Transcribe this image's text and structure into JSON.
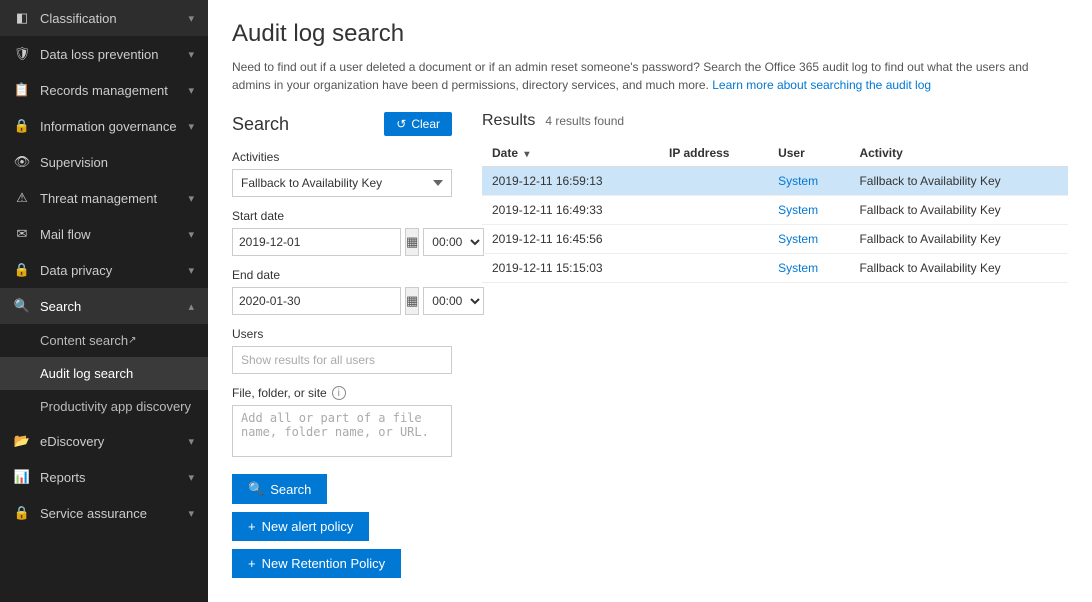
{
  "sidebar": {
    "items": [
      {
        "id": "classification",
        "label": "Classification",
        "icon": "◧",
        "hasChevron": true,
        "expanded": false
      },
      {
        "id": "data-loss-prevention",
        "label": "Data loss prevention",
        "icon": "🛡",
        "hasChevron": true,
        "expanded": false
      },
      {
        "id": "records-management",
        "label": "Records management",
        "icon": "📋",
        "hasChevron": true,
        "expanded": false
      },
      {
        "id": "information-governance",
        "label": "Information governance",
        "icon": "🔒",
        "hasChevron": true,
        "expanded": false
      },
      {
        "id": "supervision",
        "label": "Supervision",
        "icon": "👁",
        "hasChevron": false,
        "expanded": false
      },
      {
        "id": "threat-management",
        "label": "Threat management",
        "icon": "⚠",
        "hasChevron": true,
        "expanded": false
      },
      {
        "id": "mail-flow",
        "label": "Mail flow",
        "icon": "✉",
        "hasChevron": true,
        "expanded": false
      },
      {
        "id": "data-privacy",
        "label": "Data privacy",
        "icon": "🔒",
        "hasChevron": true,
        "expanded": false
      },
      {
        "id": "search",
        "label": "Search",
        "icon": "🔍",
        "hasChevron": true,
        "expanded": true
      }
    ],
    "sub_items": [
      {
        "id": "content-search",
        "label": "Content search",
        "hasExternalIcon": true
      },
      {
        "id": "audit-log-search",
        "label": "Audit log search",
        "active": true
      },
      {
        "id": "productivity-app-discovery",
        "label": "Productivity app discovery"
      }
    ],
    "more_items": [
      {
        "id": "ediscovery",
        "label": "eDiscovery",
        "icon": "📂",
        "hasChevron": true
      },
      {
        "id": "reports",
        "label": "Reports",
        "icon": "📊",
        "hasChevron": true
      },
      {
        "id": "service-assurance",
        "label": "Service assurance",
        "icon": "🔒",
        "hasChevron": true
      }
    ]
  },
  "page": {
    "title": "Audit log search",
    "description": "Need to find out if a user deleted a document or if an admin reset someone's password? Search the Office 365 audit log to find out what the users and admins in your organization have been d permissions, directory services, and much more.",
    "learn_more_text": "Learn more about searching the audit log",
    "learn_more_url": "#"
  },
  "search_panel": {
    "title": "Search",
    "clear_label": "Clear",
    "activities_label": "Activities",
    "activities_value": "Fallback to Availability Key",
    "start_date_label": "Start date",
    "start_date_value": "2019-12-01",
    "start_time_value": "00:00",
    "end_date_label": "End date",
    "end_date_value": "2020-01-30",
    "end_time_value": "00:00",
    "users_label": "Users",
    "users_placeholder": "Show results for all users",
    "file_folder_label": "File, folder, or site",
    "file_folder_placeholder": "Add all or part of a file name, folder name, or URL.",
    "search_button_label": "Search",
    "new_alert_policy_label": "New alert policy",
    "new_retention_policy_label": "New Retention Policy"
  },
  "results": {
    "title": "Results",
    "count_text": "4 results found",
    "columns": [
      {
        "id": "date",
        "label": "Date",
        "sortable": true
      },
      {
        "id": "ip_address",
        "label": "IP address",
        "sortable": false
      },
      {
        "id": "user",
        "label": "User",
        "sortable": false
      },
      {
        "id": "activity",
        "label": "Activity",
        "sortable": false
      }
    ],
    "rows": [
      {
        "date": "2019-12-11 16:59:13",
        "ip_address": "",
        "user": "System",
        "activity": "Fallback to Availability Key",
        "selected": true
      },
      {
        "date": "2019-12-11 16:49:33",
        "ip_address": "",
        "user": "System",
        "activity": "Fallback to Availability Key",
        "selected": false
      },
      {
        "date": "2019-12-11 16:45:56",
        "ip_address": "",
        "user": "System",
        "activity": "Fallback to Availability Key",
        "selected": false
      },
      {
        "date": "2019-12-11 15:15:03",
        "ip_address": "",
        "user": "System",
        "activity": "Fallback to Availability Key",
        "selected": false
      }
    ]
  },
  "icons": {
    "clear": "↺",
    "calendar": "📅",
    "search": "🔍",
    "plus": "+",
    "info": "i",
    "chevron_down": "▾",
    "chevron_up": "▴",
    "external": "↗"
  }
}
